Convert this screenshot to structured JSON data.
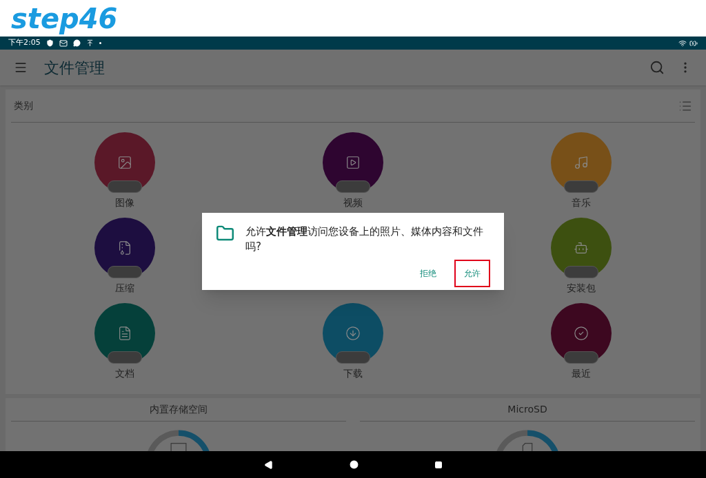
{
  "step_label": "step46",
  "status_bar": {
    "time": "下午2:05"
  },
  "app_bar": {
    "title": "文件管理"
  },
  "categories": {
    "title": "类别",
    "items": [
      {
        "label": "图像",
        "color": "#5a1828",
        "kind": "image"
      },
      {
        "label": "视频",
        "color": "#2e0530",
        "kind": "video"
      },
      {
        "label": "音乐",
        "color": "#785018",
        "kind": "music"
      },
      {
        "label": "压缩",
        "color": "#1d0e40",
        "kind": "archive"
      },
      {
        "label": "安装包",
        "color": "#3d5010",
        "kind": "apk"
      },
      {
        "label": "文档",
        "color": "#05403a",
        "kind": "document"
      },
      {
        "label": "下载",
        "color": "#0d4d64",
        "kind": "download"
      },
      {
        "label": "最近",
        "color": "#3d0820",
        "kind": "recent"
      }
    ]
  },
  "storage": [
    {
      "title": "内置存储空间",
      "kind": "internal"
    },
    {
      "title": "MicroSD",
      "kind": "sd"
    }
  ],
  "dialog": {
    "message": "允许**文件管理**访问您设备上的照片、媒体内容和文件吗?",
    "buttons": [
      {
        "label": "拒绝",
        "highlighted": false
      },
      {
        "label": "允许",
        "highlighted": true
      }
    ]
  }
}
